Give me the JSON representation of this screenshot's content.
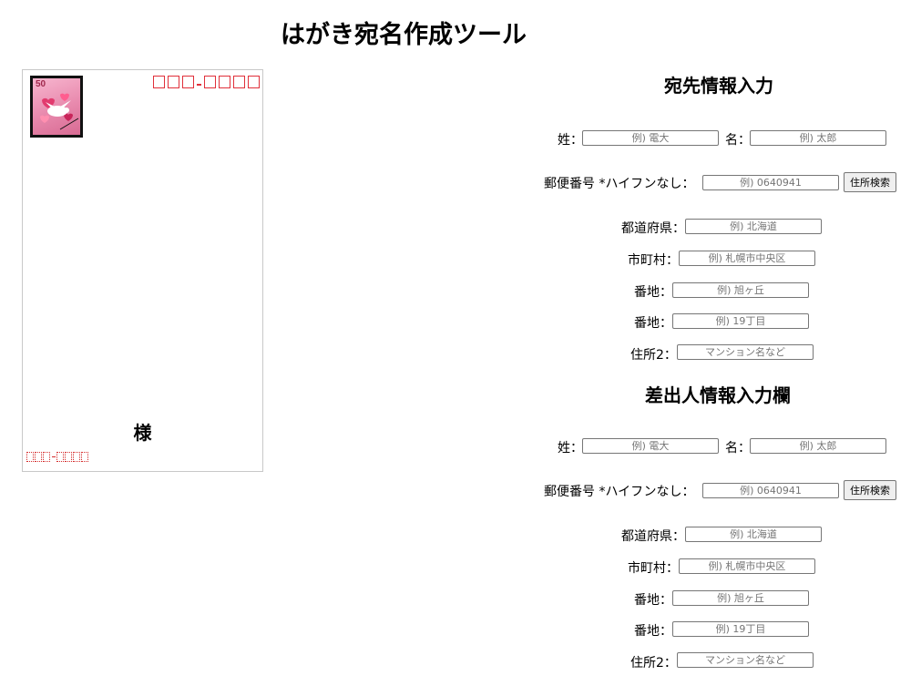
{
  "page": {
    "title": "はがき宛名作成ツール"
  },
  "postcard": {
    "stamp_value": "50",
    "honorific": "様",
    "zip_dash": "-",
    "colors": {
      "zip_box": "#e0303a",
      "sender_zip_box": "#d42a2a"
    }
  },
  "recipient": {
    "heading": "宛先情報入力",
    "last_name": {
      "label": "姓：",
      "placeholder": "例) 電大",
      "value": ""
    },
    "first_name": {
      "label": "名：",
      "placeholder": "例) 太郎",
      "value": ""
    },
    "postal": {
      "label": "郵便番号 *ハイフンなし：",
      "placeholder": "例) 0640941",
      "value": "",
      "button": "住所検索"
    },
    "prefecture": {
      "label": "都道府県：",
      "placeholder": "例) 北海道",
      "value": ""
    },
    "city": {
      "label": "市町村：",
      "placeholder": "例) 札幌市中央区",
      "value": ""
    },
    "town": {
      "label": "番地：",
      "placeholder": "例) 旭ヶ丘",
      "value": ""
    },
    "block": {
      "label": "番地：",
      "placeholder": "例) 19丁目",
      "value": ""
    },
    "address2": {
      "label": "住所2：",
      "placeholder": "マンション名など",
      "value": ""
    }
  },
  "sender": {
    "heading": "差出人情報入力欄",
    "last_name": {
      "label": "姓：",
      "placeholder": "例) 電大",
      "value": ""
    },
    "first_name": {
      "label": "名：",
      "placeholder": "例) 太郎",
      "value": ""
    },
    "postal": {
      "label": "郵便番号 *ハイフンなし：",
      "placeholder": "例) 0640941",
      "value": "",
      "button": "住所検索"
    },
    "prefecture": {
      "label": "都道府県：",
      "placeholder": "例) 北海道",
      "value": ""
    },
    "city": {
      "label": "市町村：",
      "placeholder": "例) 札幌市中央区",
      "value": ""
    },
    "town": {
      "label": "番地：",
      "placeholder": "例) 旭ヶ丘",
      "value": ""
    },
    "block": {
      "label": "番地：",
      "placeholder": "例) 19丁目",
      "value": ""
    },
    "address2": {
      "label": "住所2：",
      "placeholder": "マンション名など",
      "value": ""
    }
  }
}
